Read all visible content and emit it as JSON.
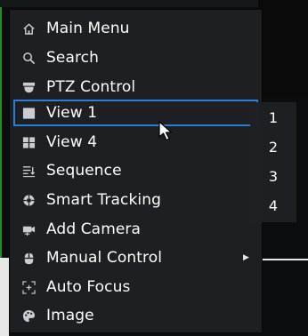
{
  "menu": {
    "items": [
      {
        "label": "Main Menu",
        "icon": "home-icon"
      },
      {
        "label": "Search",
        "icon": "search-icon"
      },
      {
        "label": "PTZ Control",
        "icon": "ptz-camera-icon"
      },
      {
        "label": "View 1",
        "icon": "single-view-icon",
        "selected": true
      },
      {
        "label": "View 4",
        "icon": "quad-view-icon"
      },
      {
        "label": "Sequence",
        "icon": "sequence-icon"
      },
      {
        "label": "Smart Tracking",
        "icon": "smart-tracking-icon"
      },
      {
        "label": "Add Camera",
        "icon": "add-camera-icon"
      },
      {
        "label": "Manual Control",
        "icon": "manual-control-icon",
        "has_submenu": true
      },
      {
        "label": "Auto Focus",
        "icon": "auto-focus-icon"
      },
      {
        "label": "Image",
        "icon": "image-icon"
      }
    ]
  },
  "submenu": {
    "items": [
      "1",
      "2",
      "3",
      "4"
    ]
  },
  "colors": {
    "menu_background": "#1e2024",
    "selection_outline": "#2a7ed8",
    "text": "#ffffff",
    "icon": "#c9ccd1"
  }
}
